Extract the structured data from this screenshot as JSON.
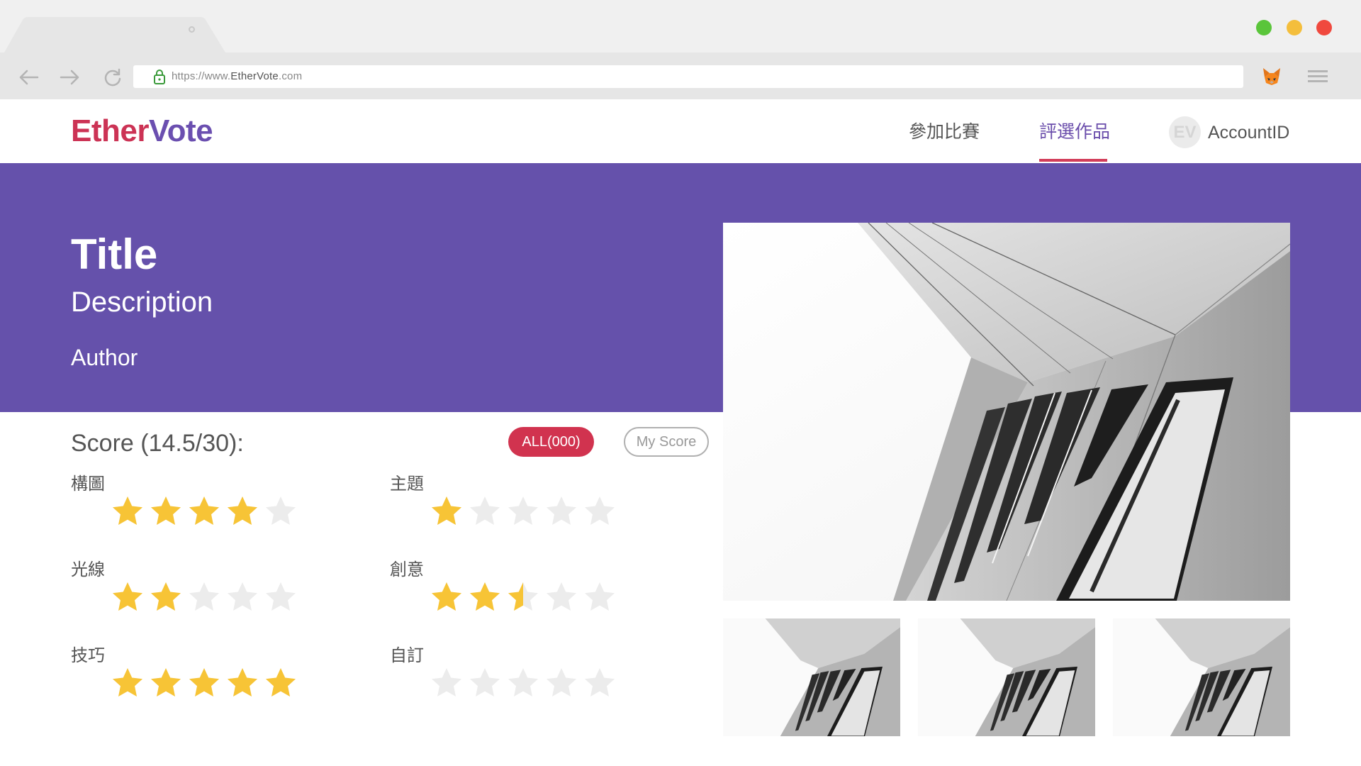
{
  "browser": {
    "url_prefix": "https://www.",
    "url_host": "EtherVote",
    "url_suffix": ".com"
  },
  "header": {
    "logo_part1": "Ether",
    "logo_part2": "Vote",
    "nav": [
      {
        "label": "參加比賽",
        "active": false
      },
      {
        "label": "評選作品",
        "active": true
      }
    ],
    "avatar_initials": "EV",
    "account_label": "AccountID"
  },
  "hero": {
    "title": "Title",
    "description": "Description",
    "author": "Author"
  },
  "score": {
    "title": "Score (14.5/30):",
    "earned": 14.5,
    "max": 30,
    "filter_all_label": "ALL(000)",
    "filter_my_label": "My Score",
    "active_filter": "all",
    "star_max": 5,
    "categories": [
      {
        "label": "構圖",
        "rating": 4
      },
      {
        "label": "主題",
        "rating": 1
      },
      {
        "label": "光線",
        "rating": 2
      },
      {
        "label": "創意",
        "rating": 2.5
      },
      {
        "label": "技巧",
        "rating": 5
      },
      {
        "label": "自訂",
        "rating": 0
      }
    ]
  },
  "gallery": {
    "thumbnail_count": 3
  },
  "colors": {
    "brand_red": "#cc3355",
    "brand_purple": "#6551ab",
    "star_gold": "#f7c436",
    "star_empty": "#ececec",
    "badge_red": "#d1334f"
  },
  "icons": {
    "back": "arrow-left-icon",
    "forward": "arrow-right-icon",
    "reload": "reload-icon",
    "lock": "lock-icon",
    "extension": "fox-extension-icon",
    "menu": "hamburger-menu-icon",
    "star": "star-icon"
  }
}
